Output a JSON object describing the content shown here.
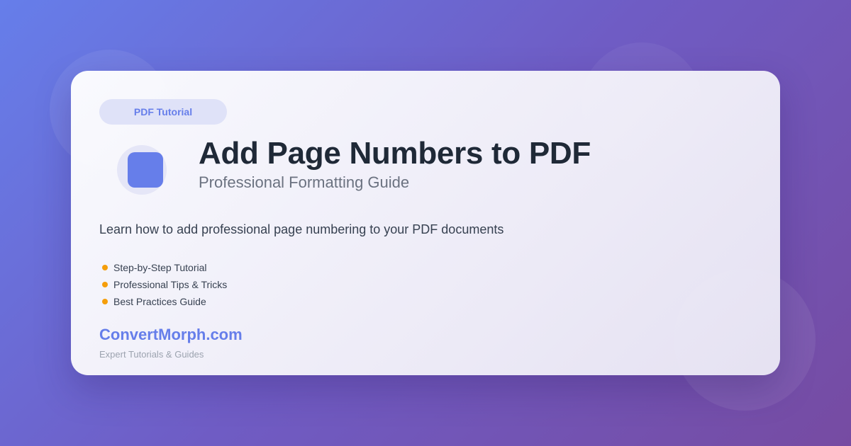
{
  "badge": {
    "label": "PDF Tutorial"
  },
  "header": {
    "icon": "document-icon",
    "title": "Add Page Numbers to PDF",
    "subtitle": "Professional Formatting Guide"
  },
  "description": "Learn how to add professional page numbering to your PDF documents",
  "features": [
    {
      "label": "Step-by-Step Tutorial"
    },
    {
      "label": "Professional Tips & Tricks"
    },
    {
      "label": "Best Practices Guide"
    }
  ],
  "brand": {
    "name": "ConvertMorph.com",
    "tagline": "Expert Tutorials & Guides"
  },
  "colors": {
    "accent": "#667eea",
    "bullet": "#f59e0b",
    "title": "#1f2937",
    "background_start": "#667eea",
    "background_end": "#764ba2"
  }
}
